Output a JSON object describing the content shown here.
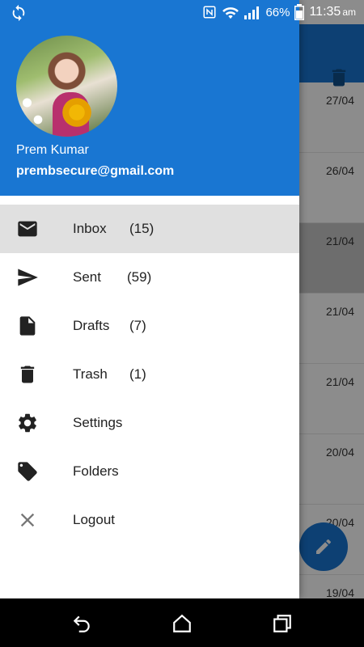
{
  "status_bar": {
    "battery": "66%",
    "time": "11:35",
    "ampm": "am"
  },
  "background_list": {
    "dates": [
      "27/04",
      "26/04",
      "21/04",
      "21/04",
      "21/04",
      "20/04",
      "20/04",
      "19/04"
    ]
  },
  "drawer": {
    "user_name": "Prem Kumar",
    "user_email": "prembsecure@gmail.com",
    "items": [
      {
        "label": "Inbox",
        "count": "(15)",
        "icon": "mail-icon"
      },
      {
        "label": "Sent",
        "count": "(59)",
        "icon": "send-icon"
      },
      {
        "label": "Drafts",
        "count": "(7)",
        "icon": "file-icon"
      },
      {
        "label": "Trash",
        "count": "(1)",
        "icon": "trash-icon"
      },
      {
        "label": "Settings",
        "count": "",
        "icon": "gear-icon"
      },
      {
        "label": "Folders",
        "count": "",
        "icon": "tag-icon"
      },
      {
        "label": "Logout",
        "count": "",
        "icon": "close-icon"
      }
    ]
  },
  "colors": {
    "primary": "#1976d2",
    "active_item": "#e0e0e0"
  }
}
